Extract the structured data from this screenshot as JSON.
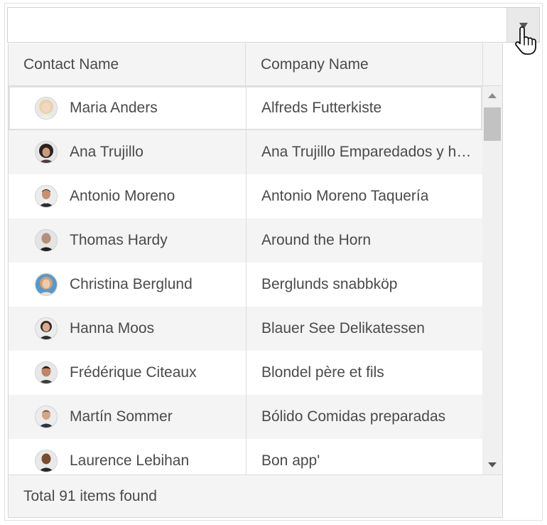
{
  "combo": {
    "value": "",
    "placeholder": ""
  },
  "columns": {
    "contact": "Contact Name",
    "company": "Company Name"
  },
  "rows": [
    {
      "name": "Maria Anders",
      "company": "Alfreds Futterkiste",
      "avatar": "female-blonde-avatar"
    },
    {
      "name": "Ana Trujillo",
      "company": "Ana Trujillo Emparedados y helados",
      "avatar": "female-dark-hair-avatar"
    },
    {
      "name": "Antonio Moreno",
      "company": "Antonio Moreno Taquería",
      "avatar": "male-suit-avatar"
    },
    {
      "name": "Thomas Hardy",
      "company": "Around the Horn",
      "avatar": "male-gray-hair-avatar"
    },
    {
      "name": "Christina Berglund",
      "company": "Berglunds snabbköp",
      "avatar": "female-blue-bg-avatar"
    },
    {
      "name": "Hanna Moos",
      "company": "Blauer See Delikatessen",
      "avatar": "female-short-hair-avatar"
    },
    {
      "name": "Frédérique Citeaux",
      "company": "Blondel père et fils",
      "avatar": "male-dark-hair-avatar"
    },
    {
      "name": "Martín Sommer",
      "company": "Bólido Comidas preparadas",
      "avatar": "male-short-hair-avatar"
    },
    {
      "name": "Laurence Lebihan",
      "company": "Bon app'",
      "avatar": "male-bald-avatar"
    }
  ],
  "footer": {
    "text": "Total 91 items found"
  },
  "colors": {
    "header_bg": "#f4f4f4",
    "alt_row_bg": "#f4f4f4",
    "border": "#dcdcdc",
    "text": "#4a4a4a",
    "scroll_thumb": "#c2c2c2"
  }
}
